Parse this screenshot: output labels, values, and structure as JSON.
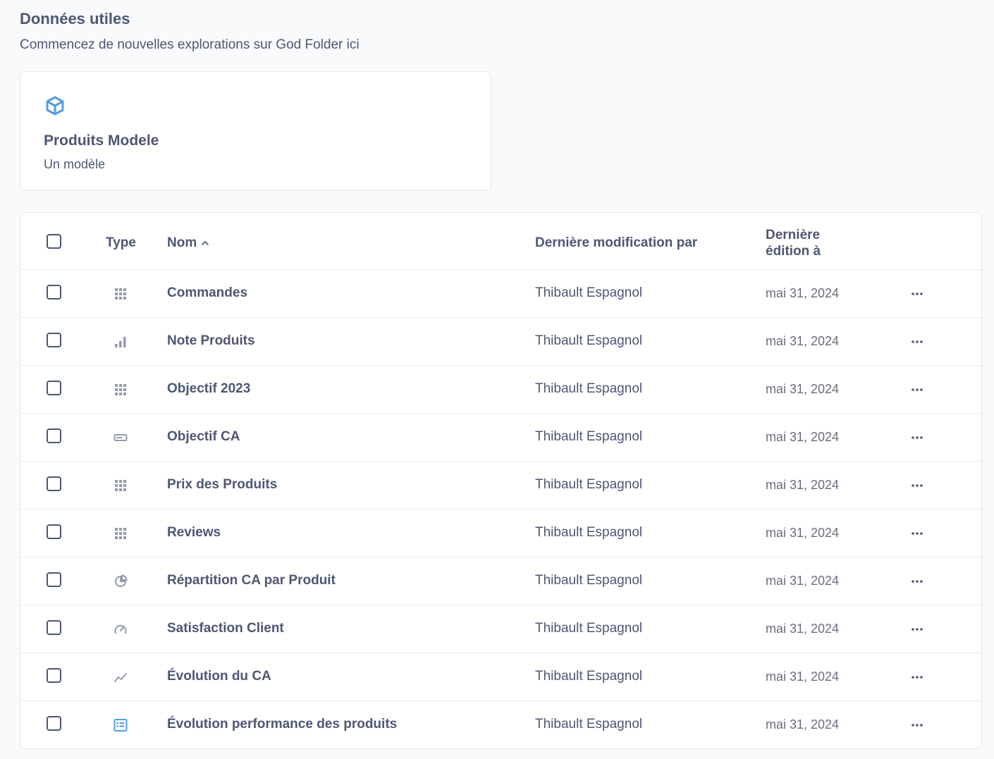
{
  "section": {
    "title": "Données utiles",
    "subtitle": "Commencez de nouvelles explorations sur God Folder ici"
  },
  "model_card": {
    "icon": "cube-icon",
    "title": "Produits Modele",
    "description": "Un modèle"
  },
  "table": {
    "headers": {
      "type": "Type",
      "name": "Nom",
      "modified_by": "Dernière modification par",
      "edited_at": "Dernière édition à"
    },
    "rows": [
      {
        "icon": "table-icon",
        "name": "Commandes",
        "modified_by": "Thibault Espagnol",
        "edited_at": "mai 31, 2024"
      },
      {
        "icon": "bar-chart-icon",
        "name": "Note Produits",
        "modified_by": "Thibault Espagnol",
        "edited_at": "mai 31, 2024"
      },
      {
        "icon": "table-icon",
        "name": "Objectif 2023",
        "modified_by": "Thibault Espagnol",
        "edited_at": "mai 31, 2024"
      },
      {
        "icon": "number-icon",
        "name": "Objectif CA",
        "modified_by": "Thibault Espagnol",
        "edited_at": "mai 31, 2024"
      },
      {
        "icon": "table-icon",
        "name": "Prix des Produits",
        "modified_by": "Thibault Espagnol",
        "edited_at": "mai 31, 2024"
      },
      {
        "icon": "table-icon",
        "name": "Reviews",
        "modified_by": "Thibault Espagnol",
        "edited_at": "mai 31, 2024"
      },
      {
        "icon": "pie-chart-icon",
        "name": "Répartition CA par Produit",
        "modified_by": "Thibault Espagnol",
        "edited_at": "mai 31, 2024"
      },
      {
        "icon": "gauge-icon",
        "name": "Satisfaction Client",
        "modified_by": "Thibault Espagnol",
        "edited_at": "mai 31, 2024"
      },
      {
        "icon": "line-chart-icon",
        "name": "Évolution du CA",
        "modified_by": "Thibault Espagnol",
        "edited_at": "mai 31, 2024"
      },
      {
        "icon": "dashboard-icon",
        "name": "Évolution performance des produits",
        "modified_by": "Thibault Espagnol",
        "edited_at": "mai 31, 2024"
      }
    ]
  },
  "colors": {
    "text": "#4c5773",
    "muted": "#696e7b",
    "icon_gray": "#949aab",
    "brand": "#509ee3",
    "border": "#e4e7ec"
  }
}
